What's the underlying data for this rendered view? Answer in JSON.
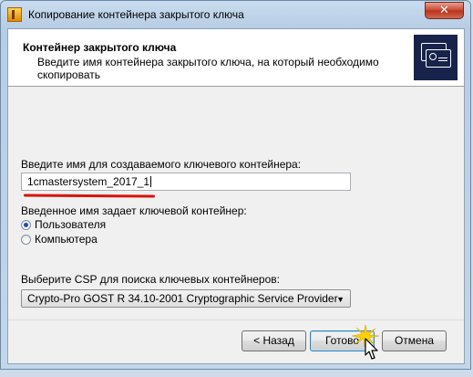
{
  "window": {
    "title": "Копирование контейнера закрытого ключа",
    "close_glyph": "✕"
  },
  "header": {
    "title": "Контейнер закрытого ключа",
    "description": "Введите имя контейнера закрытого ключа, на который необходимо скопировать",
    "image_icon": "certificate-cards-icon"
  },
  "form": {
    "name_label": "Введите имя для создаваемого ключевого контейнера:",
    "name_value": "1cmastersystem_2017_1",
    "scope_label": "Введенное имя задает ключевой контейнер:",
    "scope_options": [
      {
        "label": "Пользователя",
        "checked": true
      },
      {
        "label": "Компьютера",
        "checked": false
      }
    ],
    "csp_label": "Выберите CSP для поиска ключевых контейнеров:",
    "csp_value": "Crypto-Pro GOST R 34.10-2001 Cryptographic Service Provider"
  },
  "buttons": {
    "back": "< Назад",
    "finish": "Готово",
    "cancel": "Отмена"
  },
  "colors": {
    "annotation_underline": "#d8140a",
    "header_image_bg": "#17234a",
    "close_button": "#c8442f"
  }
}
